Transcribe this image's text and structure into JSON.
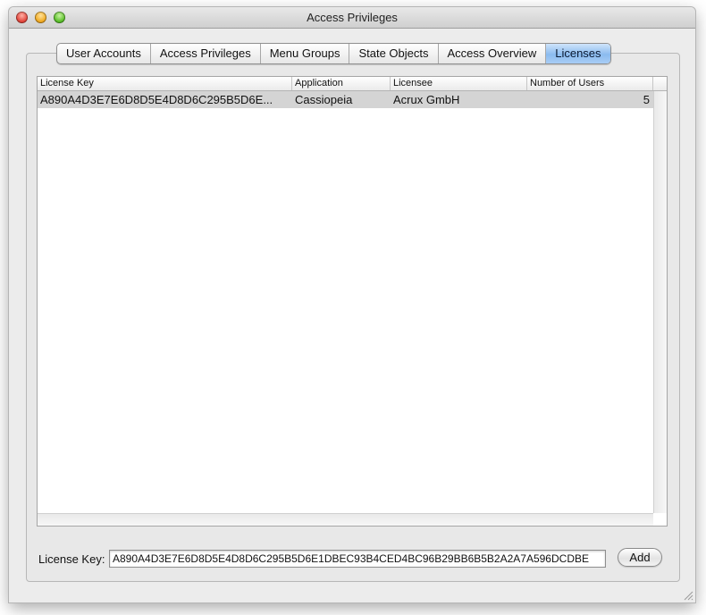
{
  "window": {
    "title": "Access Privileges"
  },
  "tabs": [
    {
      "label": "User Accounts",
      "selected": false
    },
    {
      "label": "Access Privileges",
      "selected": false
    },
    {
      "label": "Menu Groups",
      "selected": false
    },
    {
      "label": "State Objects",
      "selected": false
    },
    {
      "label": "Access Overview",
      "selected": false
    },
    {
      "label": "Licenses",
      "selected": true
    }
  ],
  "table": {
    "columns": [
      "License Key",
      "Application",
      "Licensee",
      "Number of Users"
    ],
    "rows": [
      {
        "license_key": "A890A4D3E7E6D8D5E4D8D6C295B5D6E...",
        "application": "Cassiopeia",
        "licensee": "Acrux GmbH",
        "number_of_users": "5"
      }
    ]
  },
  "form": {
    "license_key_label": "License Key:",
    "license_key_value": "A890A4D3E7E6D8D5E4D8D6C295B5D6E1DBEC93B4CED4BC96B29BB6B5B2A2A7A596DCDBE",
    "add_label": "Add"
  },
  "colors": {
    "selected_tab": "#8bbbef",
    "selected_row": "#d4d4d4",
    "window_bg": "#ececec"
  }
}
